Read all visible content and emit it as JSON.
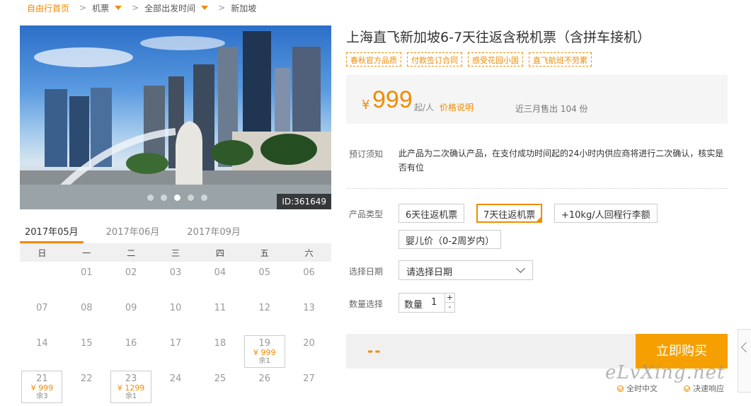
{
  "breadcrumb": {
    "home": "自由行首页",
    "item1": "机票",
    "item2": "全部出发时间",
    "item3": "新加坡"
  },
  "photo": {
    "id_label": "ID:361649"
  },
  "calendar": {
    "tabs": [
      "2017年05月",
      "2017年06月",
      "2017年09月"
    ],
    "weekdays": [
      "日",
      "一",
      "二",
      "三",
      "四",
      "五",
      "六"
    ],
    "rows": [
      [
        {
          "d": ""
        },
        {
          "d": "01"
        },
        {
          "d": "02"
        },
        {
          "d": "03"
        },
        {
          "d": "04"
        },
        {
          "d": "05"
        },
        {
          "d": "06"
        }
      ],
      [
        {
          "d": "07"
        },
        {
          "d": "08"
        },
        {
          "d": "09"
        },
        {
          "d": "10"
        },
        {
          "d": "11"
        },
        {
          "d": "12"
        },
        {
          "d": "13"
        }
      ],
      [
        {
          "d": "14"
        },
        {
          "d": "15"
        },
        {
          "d": "16"
        },
        {
          "d": "17"
        },
        {
          "d": "18"
        },
        {
          "d": "19",
          "price": "¥ 999",
          "left": "余1"
        },
        {
          "d": "20"
        }
      ],
      [
        {
          "d": "21",
          "price": "¥ 999",
          "left": "余3"
        },
        {
          "d": "22"
        },
        {
          "d": "23",
          "price": "¥ 1299",
          "left": "余1"
        },
        {
          "d": "24"
        },
        {
          "d": "25"
        },
        {
          "d": "26"
        },
        {
          "d": "27"
        }
      ]
    ]
  },
  "product": {
    "title": "上海直飞新加坡6-7天往返含税机票（含拼车接机）",
    "tags": [
      "春秋官方品质",
      "付款签订合同",
      "感受花园小国",
      "直飞航班不劳累"
    ],
    "currency": "¥",
    "price": "999",
    "per": "起/人",
    "price_note": "价格说明",
    "sold": "近三月售出 104 份"
  },
  "booking": {
    "notice_label": "预订须知",
    "notice_text": "此产品为二次确认产品，在支付成功时间起的24小时内供应商将进行二次确认，核实是否有位",
    "type_label": "产品类型",
    "types": [
      "6天往返机票",
      "7天往返机票",
      "+10kg/人回程行李额",
      "婴儿价（0-2周岁内）"
    ],
    "date_label": "选择日期",
    "date_placeholder": "请选择日期",
    "qty_label": "数量选择",
    "qty_inner_label": "数量",
    "qty_value": "1",
    "plus": "+",
    "minus": "-",
    "total": "--",
    "buy": "立即购买"
  },
  "guarantees": [
    "全时中文",
    "决速响应"
  ],
  "watermark": "eLvXing.net",
  "colors": {
    "accent": "#f08c00",
    "button": "#f5a000"
  }
}
